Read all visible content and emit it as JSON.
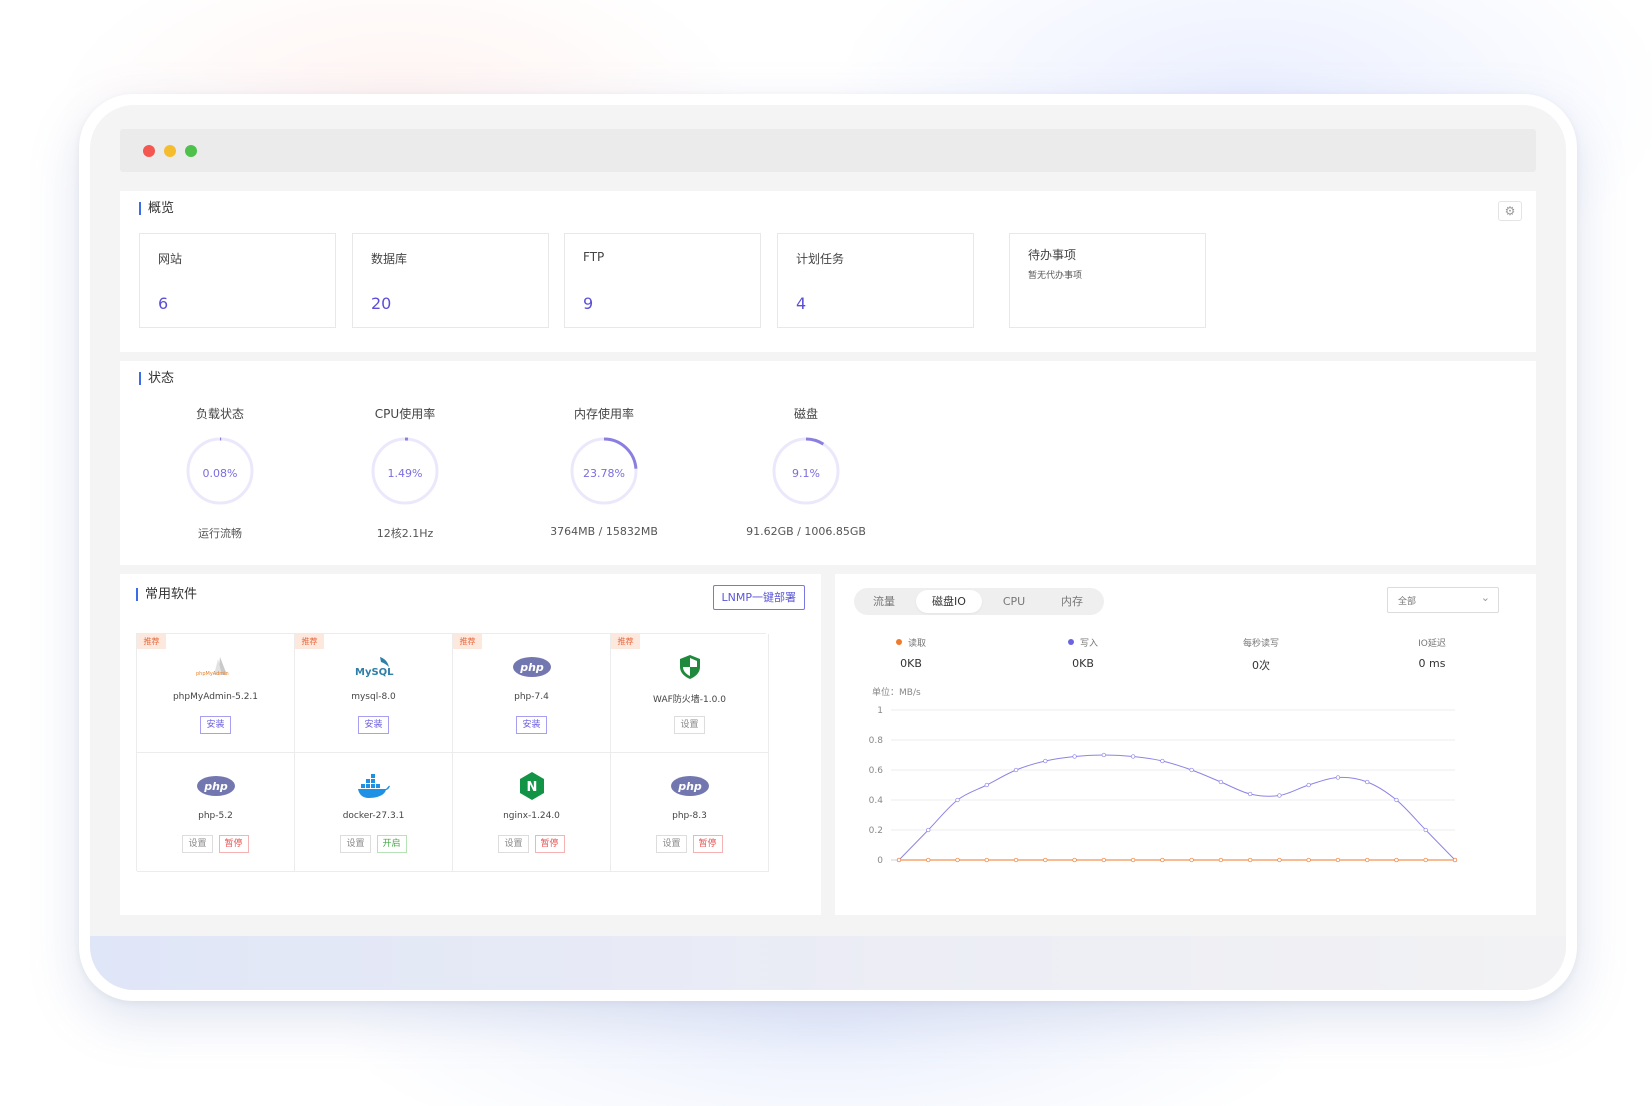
{
  "overview": {
    "title": "概览",
    "cards": [
      {
        "label": "网站",
        "value": "6"
      },
      {
        "label": "数据库",
        "value": "20"
      },
      {
        "label": "FTP",
        "value": "9"
      },
      {
        "label": "计划任务",
        "value": "4"
      }
    ],
    "todo": {
      "label": "待办事项",
      "empty": "暂无代办事项"
    }
  },
  "status": {
    "title": "状态",
    "gauges": [
      {
        "title": "负载状态",
        "value": "0.08%",
        "fraction": 0.0008,
        "sub": "运行流畅"
      },
      {
        "title": "CPU使用率",
        "value": "1.49%",
        "fraction": 0.0149,
        "sub": "12核2.1Hz"
      },
      {
        "title": "内存使用率",
        "value": "23.78%",
        "fraction": 0.2378,
        "sub": "3764MB / 15832MB"
      },
      {
        "title": "磁盘",
        "value": "9.1%",
        "fraction": 0.091,
        "sub": "91.62GB / 1006.85GB"
      }
    ]
  },
  "software": {
    "title": "常用软件",
    "lnmp_button": "LNMP一键部署",
    "badge": "推荐",
    "items": [
      {
        "name": "phpMyAdmin-5.2.1",
        "icon": "phpmyadmin-icon",
        "recommended": true,
        "actions": [
          {
            "label": "安装",
            "type": "install"
          }
        ]
      },
      {
        "name": "mysql-8.0",
        "icon": "mysql-icon",
        "recommended": true,
        "actions": [
          {
            "label": "安装",
            "type": "install"
          }
        ]
      },
      {
        "name": "php-7.4",
        "icon": "php-icon",
        "recommended": true,
        "actions": [
          {
            "label": "安装",
            "type": "install"
          }
        ]
      },
      {
        "name": "WAF防火墙-1.0.0",
        "icon": "shield-icon",
        "recommended": true,
        "actions": [
          {
            "label": "设置",
            "type": "set"
          }
        ]
      },
      {
        "name": "php-5.2",
        "icon": "php-icon",
        "recommended": false,
        "actions": [
          {
            "label": "设置",
            "type": "set"
          },
          {
            "label": "暂停",
            "type": "stop"
          }
        ]
      },
      {
        "name": "docker-27.3.1",
        "icon": "docker-icon",
        "recommended": false,
        "actions": [
          {
            "label": "设置",
            "type": "set"
          },
          {
            "label": "开启",
            "type": "start"
          }
        ]
      },
      {
        "name": "nginx-1.24.0",
        "icon": "nginx-icon",
        "recommended": false,
        "actions": [
          {
            "label": "设置",
            "type": "set"
          },
          {
            "label": "暂停",
            "type": "stop"
          }
        ]
      },
      {
        "name": "php-8.3",
        "icon": "php-icon",
        "recommended": false,
        "actions": [
          {
            "label": "设置",
            "type": "set"
          },
          {
            "label": "暂停",
            "type": "stop"
          }
        ]
      }
    ],
    "icon_texts": {
      "phpmyadmin": "phpMyAdmin",
      "mysql": "MySQL",
      "php": "php",
      "nginx": "N"
    }
  },
  "io": {
    "tabs": [
      "流量",
      "磁盘IO",
      "CPU",
      "内存"
    ],
    "active_tab": "磁盘IO",
    "select_value": "全部",
    "stats": [
      {
        "label": "读取",
        "value": "0KB",
        "dot_color": "#f07a2a"
      },
      {
        "label": "写入",
        "value": "0KB",
        "dot_color": "#6b63e0"
      },
      {
        "label": "每秒读写",
        "value": "0次"
      },
      {
        "label": "IO延迟",
        "value": "0 ms"
      }
    ],
    "unit_label": "单位：MB/s"
  },
  "chart_data": {
    "type": "line",
    "ylim": [
      0,
      1
    ],
    "y_ticks": [
      "0",
      "0.2",
      "0.4",
      "0.6",
      "0.8",
      "1"
    ],
    "grid": true,
    "series": [
      {
        "name": "读取",
        "color": "#f07a2a",
        "values": [
          0,
          0,
          0,
          0,
          0,
          0,
          0,
          0,
          0,
          0,
          0,
          0,
          0,
          0,
          0,
          0,
          0,
          0,
          0,
          0
        ]
      },
      {
        "name": "写入",
        "color": "#8d84e6",
        "values": [
          0,
          0.2,
          0.4,
          0.5,
          0.6,
          0.66,
          0.69,
          0.7,
          0.69,
          0.66,
          0.6,
          0.52,
          0.44,
          0.43,
          0.5,
          0.55,
          0.52,
          0.4,
          0.2,
          0
        ]
      }
    ]
  },
  "colors": {
    "accent": "#5b4fd9",
    "gauge_track": "#ece8fb",
    "gauge_fill": "#8a7fe0"
  }
}
